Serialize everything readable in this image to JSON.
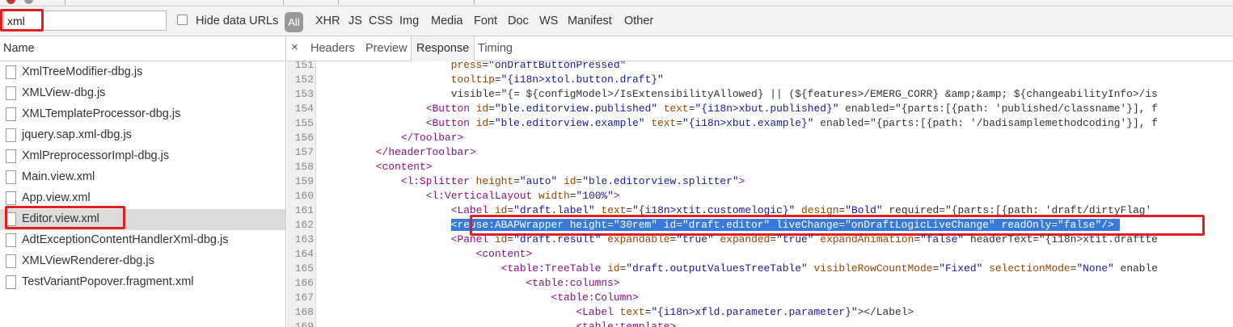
{
  "filter": {
    "value": "xml",
    "hide_data_urls_label": "Hide data URLs",
    "all_label": "All",
    "types": [
      "XHR",
      "JS",
      "CSS",
      "Img",
      "Media",
      "Font",
      "Doc",
      "WS",
      "Manifest",
      "Other"
    ]
  },
  "files": {
    "header": "Name",
    "items": [
      "XmlTreeModifier-dbg.js",
      "XMLView-dbg.js",
      "XMLTemplateProcessor-dbg.js",
      "jquery.sap.xml-dbg.js",
      "XmlPreprocessorImpl-dbg.js",
      "Main.view.xml",
      "App.view.xml",
      "Editor.view.xml",
      "AdtExceptionContentHandlerXml-dbg.js",
      "XMLViewRenderer-dbg.js",
      "TestVariantPopover.fragment.xml"
    ],
    "selected_index": 7
  },
  "tabs": {
    "close_icon": "×",
    "items": [
      "Headers",
      "Preview",
      "Response",
      "Timing"
    ],
    "active": "Response"
  },
  "code": {
    "lines": [
      {
        "n": "151",
        "t": "                    press=\"onDraftButtonPressed\""
      },
      {
        "n": "152",
        "t": "                    tooltip=\"{i18n>xtol.button.draft}\""
      },
      {
        "n": "153",
        "t": "                    visible=\"{= ${configModel>/IsExtensibilityAllowed} || (${features>/EMERG_CORR} &amp;&amp; ${changeabilityInfo>/is"
      },
      {
        "n": "154",
        "t": "                <Button id=\"ble.editorview.published\" text=\"{i18n>xbut.published}\" enabled=\"{parts:[{path: 'published/classname'}], f"
      },
      {
        "n": "155",
        "t": "                <Button id=\"ble.editorview.example\" text=\"{i18n>xbut.example}\" enabled=\"{parts:[{path: '/badisamplemethodcoding'}], f"
      },
      {
        "n": "156",
        "t": "            </Toolbar>"
      },
      {
        "n": "157",
        "t": "        </headerToolbar>"
      },
      {
        "n": "158",
        "t": "        <content>"
      },
      {
        "n": "159",
        "t": "            <l:Splitter height=\"auto\" id=\"ble.editorview.splitter\">"
      },
      {
        "n": "160",
        "t": "                <l:VerticalLayout width=\"100%\">"
      },
      {
        "n": "161",
        "t": "                    <Label id=\"draft.label\" text=\"{i18n>xtit.customelogic}\" design=\"Bold\" required=\"{parts:[{path: 'draft/dirtyFlag'"
      },
      {
        "n": "162",
        "t": "                    <reuse:ABAPWrapper height=\"30rem\" id=\"draft.editor\" liveChange=\"onDraftLogicLiveChange\" readOnly=\"false\"/>"
      },
      {
        "n": "163",
        "t": "                    <Panel id=\"draft.result\" expandable=\"true\" expanded=\"true\" expandAnimation=\"false\" headerText=\"{i18n>xtit.draftte"
      },
      {
        "n": "164",
        "t": "                        <content>"
      },
      {
        "n": "165",
        "t": "                            <table:TreeTable id=\"draft.outputValuesTreeTable\" visibleRowCountMode=\"Fixed\" selectionMode=\"None\" enable"
      },
      {
        "n": "166",
        "t": "                                <table:columns>"
      },
      {
        "n": "167",
        "t": "                                    <table:Column>"
      },
      {
        "n": "168",
        "t": "                                        <Label text=\"{i18n>xfld.parameter.parameter}\"></Label>"
      },
      {
        "n": "169",
        "t": "                                        <table:template>"
      }
    ],
    "selected_line": "162"
  },
  "colors": {
    "highlight_red": "#e02020",
    "selection_blue": "#3879d9",
    "tag": "#881280",
    "attr": "#994500",
    "value": "#1a1aa6"
  }
}
